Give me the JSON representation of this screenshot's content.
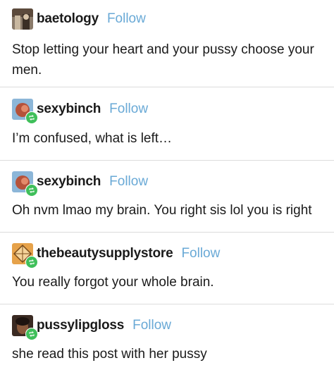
{
  "follow_label": "Follow",
  "posts": [
    {
      "username": "baetology",
      "text": "Stop letting your heart and your pussy choose your men.",
      "reblogged": false
    },
    {
      "username": "sexybinch",
      "text": "I’m confused, what is left…",
      "reblogged": true
    },
    {
      "username": "sexybinch",
      "text": "Oh nvm lmao my brain. You right sis lol you is right",
      "reblogged": true
    },
    {
      "username": "thebeautysupplystore",
      "text": "You really forgot your whole brain.",
      "reblogged": true
    },
    {
      "username": "pussylipgloss",
      "text": "she read this post with her pussy",
      "reblogged": true
    }
  ],
  "colors": {
    "follow": "#69a9d6",
    "reblog_badge": "#3fbf5a",
    "divider": "#dcdcdc"
  },
  "icons": {
    "reblog_badge": "reblog-icon"
  }
}
